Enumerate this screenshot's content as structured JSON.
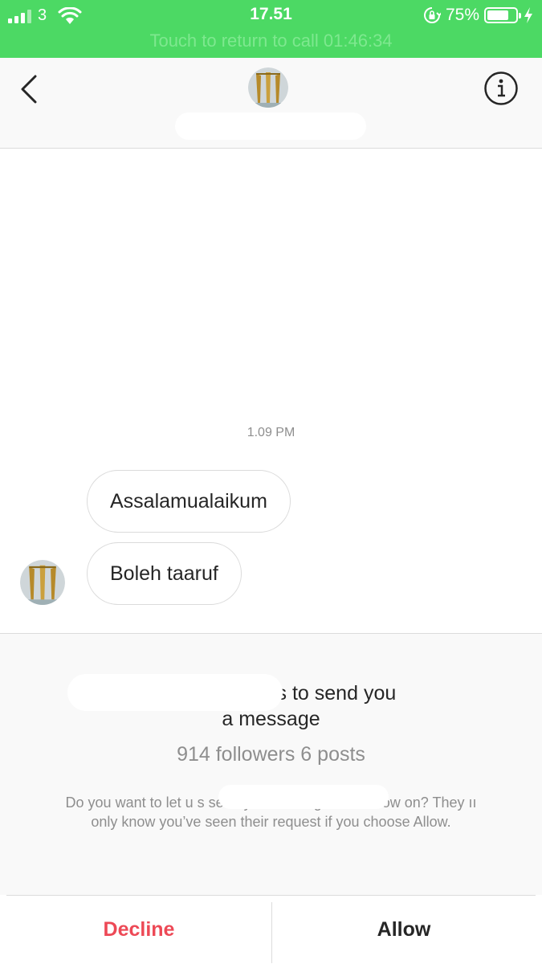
{
  "status_bar": {
    "carrier": "3",
    "time": "17.51",
    "battery": "75%",
    "battery_level": 0.75,
    "call_banner": "Touch to return to call 01:46:34",
    "icons": [
      "signal-icon",
      "wifi-icon",
      "rotation-lock-icon",
      "battery-icon",
      "charging-bolt-icon"
    ]
  },
  "header": {
    "icons": [
      "back-chevron-icon",
      "avatar",
      "info-icon"
    ]
  },
  "conversation": {
    "timestamp": "1.09 PM",
    "messages": [
      "Assalamualaikum",
      "Boleh taaruf"
    ]
  },
  "request": {
    "title_line1": "wants to send you",
    "title_line2": "a message",
    "stats": "914 followers 6 posts",
    "body": "Do you want to let u​                                     ​s send you messages from now on? They ıı only know you’ve seen their request if you choose Allow.",
    "decline_label": "Decline",
    "allow_label": "Allow"
  },
  "colors": {
    "status_bar_bg": "#4cd964",
    "decline": "#ed4956",
    "text_primary": "#262626",
    "text_secondary": "#8e8e8e"
  }
}
